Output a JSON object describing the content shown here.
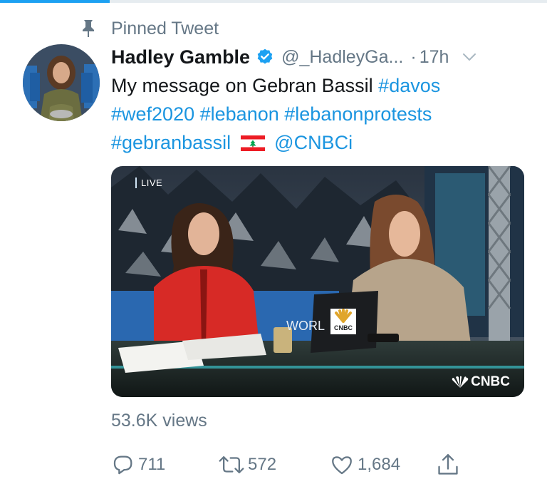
{
  "pinned": {
    "label": "Pinned Tweet",
    "icon": "pin-icon"
  },
  "author": {
    "name": "Hadley Gamble",
    "handle": "@_HadleyGa...",
    "separator": "·",
    "time": "17h",
    "verified_icon": "verified-badge-icon"
  },
  "tweet": {
    "plain_1": "My message on Gebran Bassil ",
    "hashtag_1": "#davos",
    "hashtag_2": "#wef2020",
    "hashtag_3": "#lebanon",
    "hashtag_4": "#lebanonprotests",
    "hashtag_5": "#gebranbassil",
    "flag_icon": "lebanon-flag-icon",
    "mention": "@CNBCi"
  },
  "media": {
    "live_label": "LIVE",
    "overlay_text": "WORL",
    "laptop_label": "CNBC",
    "channel_logo": "CNBC"
  },
  "stats": {
    "views": "53.6K views"
  },
  "actions": {
    "replies": "711",
    "retweets": "572",
    "likes": "1,684"
  },
  "colors": {
    "accent": "#1da1f2",
    "link": "#1b95e0",
    "secondary_text": "#657786",
    "primary_text": "#14171a"
  },
  "progress": {
    "fraction": 0.2
  }
}
